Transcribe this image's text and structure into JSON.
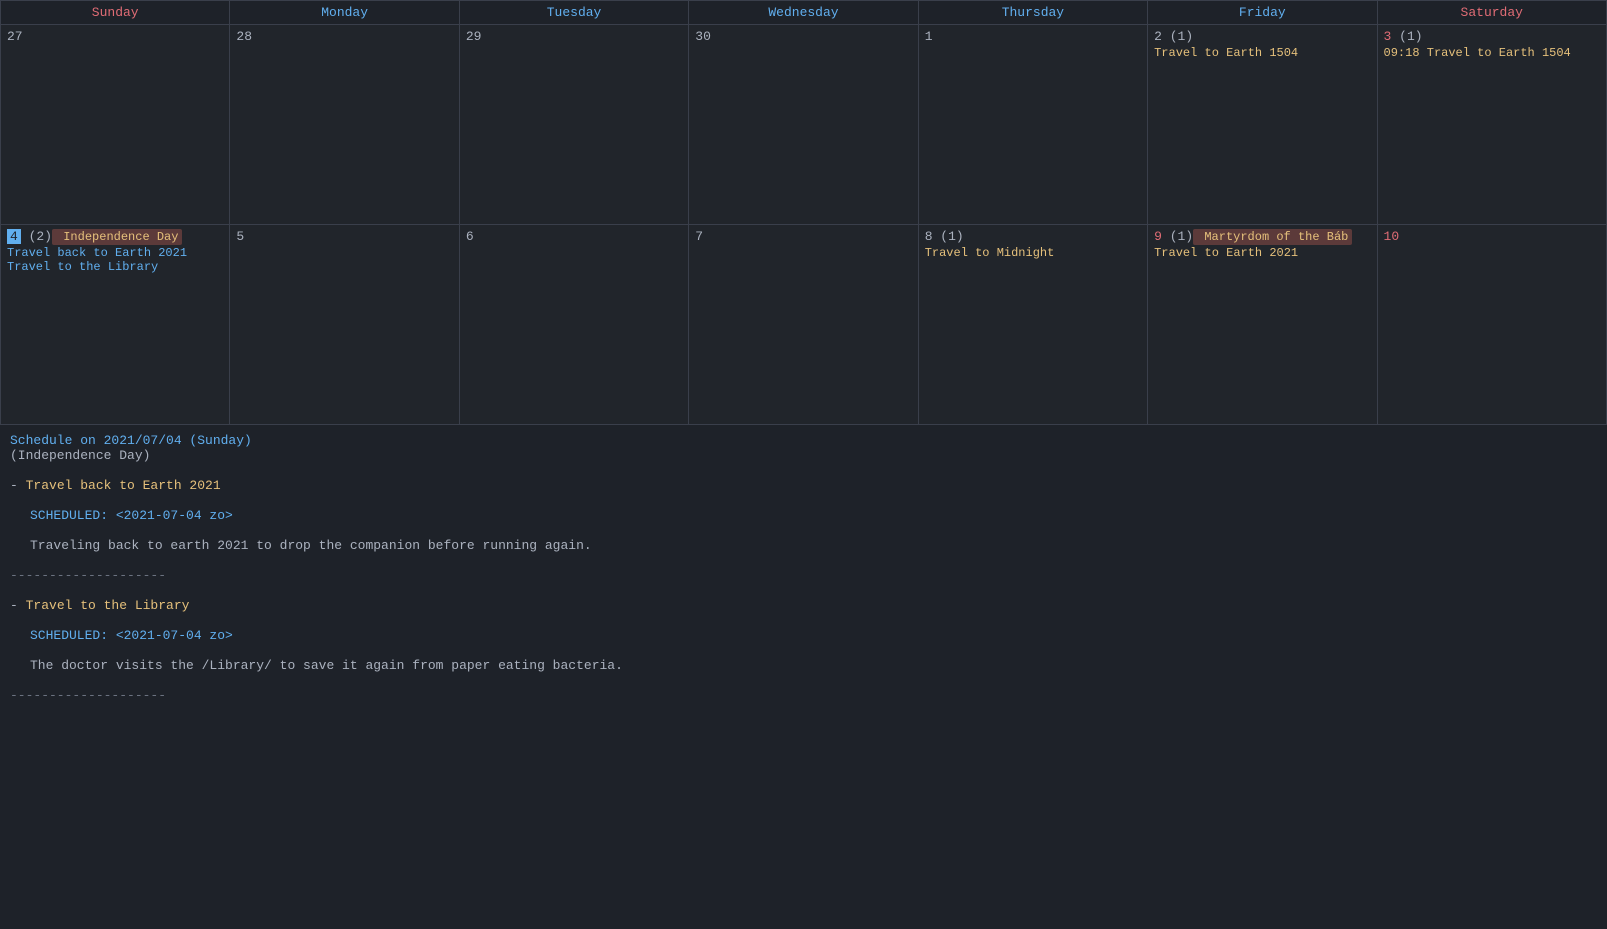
{
  "calendar": {
    "headers": [
      {
        "label": "Sunday",
        "class": "sunday"
      },
      {
        "label": "Monday",
        "class": "monday"
      },
      {
        "label": "Tuesday",
        "class": "tuesday"
      },
      {
        "label": "Wednesday",
        "class": "wednesday"
      },
      {
        "label": "Thursday",
        "class": "thursday"
      },
      {
        "label": "Friday",
        "class": "friday"
      },
      {
        "label": "Saturday",
        "class": "saturday"
      }
    ],
    "weeks": [
      {
        "days": [
          {
            "number": "27",
            "style": "normal",
            "events": []
          },
          {
            "number": "28",
            "style": "normal",
            "events": []
          },
          {
            "number": "29",
            "style": "normal",
            "events": []
          },
          {
            "number": "30",
            "style": "normal",
            "events": []
          },
          {
            "number": "1",
            "style": "normal",
            "events": []
          },
          {
            "number": "2",
            "style": "normal",
            "count": "(1)",
            "events": [
              {
                "text": "Travel to Earth 1504",
                "color": "orange"
              }
            ]
          },
          {
            "number": "3",
            "style": "red",
            "count": "(1)",
            "events": [
              {
                "text": "09:18 Travel to Earth 1504",
                "color": "orange"
              }
            ]
          }
        ]
      },
      {
        "days": [
          {
            "number": "4",
            "style": "highlight",
            "count": "(2)",
            "holiday": "Independence Day",
            "events": [
              {
                "text": "Travel back to Earth 2021",
                "color": "normal"
              },
              {
                "text": "Travel to the Library",
                "color": "normal"
              }
            ]
          },
          {
            "number": "5",
            "style": "normal",
            "events": []
          },
          {
            "number": "6",
            "style": "normal",
            "events": []
          },
          {
            "number": "7",
            "style": "normal",
            "events": []
          },
          {
            "number": "8",
            "style": "normal",
            "count": "(1)",
            "events": [
              {
                "text": "Travel to Midnight",
                "color": "orange"
              }
            ]
          },
          {
            "number": "9",
            "style": "red",
            "count": "(1)",
            "holiday": "Martyrdom of the Báb",
            "events": [
              {
                "text": "Travel to Earth 2021",
                "color": "orange"
              }
            ]
          },
          {
            "number": "10",
            "style": "red",
            "events": []
          }
        ]
      }
    ]
  },
  "schedule": {
    "title": "Schedule on 2021/07/04 (Sunday)",
    "subtitle": "(Independence Day)",
    "items": [
      {
        "title": "Travel back to Earth 2021",
        "scheduled": "SCHEDULED: <2021-07-04 zo>",
        "body": "Traveling back to earth 2021 to drop the companion before running again."
      },
      {
        "title": "Travel to the Library",
        "scheduled": "SCHEDULED: <2021-07-04 zo>",
        "body": "The doctor visits the /Library/ to save it again from paper eating bacteria."
      }
    ],
    "divider": "--------------------"
  }
}
